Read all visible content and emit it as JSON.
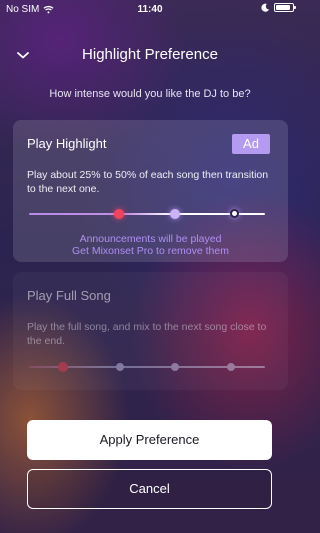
{
  "status_bar": {
    "carrier": "No SIM",
    "time": "11:40"
  },
  "header": {
    "title": "Highlight Preference"
  },
  "question": "How intense would you like the DJ to be?",
  "options": [
    {
      "title": "Play Highlight",
      "badge": "Ad",
      "description": "Play about 25% to 50% of each song then transition to the next one.",
      "promo_line_1": "Announcements will be played",
      "promo_line_2": "Get Mixonset Pro to remove them",
      "selected": true
    },
    {
      "title": "Play Full Song",
      "description": "Play the full song, and mix to the next song close to the end.",
      "selected": false
    }
  ],
  "buttons": {
    "apply": "Apply Preference",
    "cancel": "Cancel"
  },
  "colors": {
    "accent": "#b49af0",
    "promo_text": "#b08ef2",
    "slider_marker_red": "#f0445e"
  }
}
